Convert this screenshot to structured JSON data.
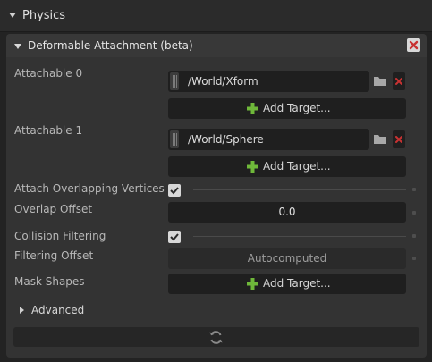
{
  "header": {
    "title": "Physics"
  },
  "panel": {
    "title": "Deformable Attachment (beta)"
  },
  "attachables": [
    {
      "label": "Attachable 0",
      "target": "/World/Xform",
      "add_label": "Add Target..."
    },
    {
      "label": "Attachable 1",
      "target": "/World/Sphere",
      "add_label": "Add Target..."
    }
  ],
  "attach_overlapping": {
    "label": "Attach Overlapping Vertices",
    "checked": true
  },
  "overlap_offset": {
    "label": "Overlap Offset",
    "value": "0.0"
  },
  "collision_filtering": {
    "label": "Collision Filtering",
    "checked": true
  },
  "filtering_offset": {
    "label": "Filtering Offset",
    "value": "Autocomputed"
  },
  "mask_shapes": {
    "label": "Mask Shapes",
    "add_label": "Add Target..."
  },
  "advanced": {
    "label": "Advanced"
  },
  "colors": {
    "accent_green": "#6fb83a",
    "remove_red": "#c83232",
    "background": "#232323",
    "panel": "#333333",
    "field": "#1f1f1f"
  },
  "icons": [
    "collapse-triangle-icon",
    "close-icon",
    "grip-icon",
    "folder-icon",
    "remove-icon",
    "plus-icon",
    "checkmark-icon",
    "refresh-icon"
  ]
}
